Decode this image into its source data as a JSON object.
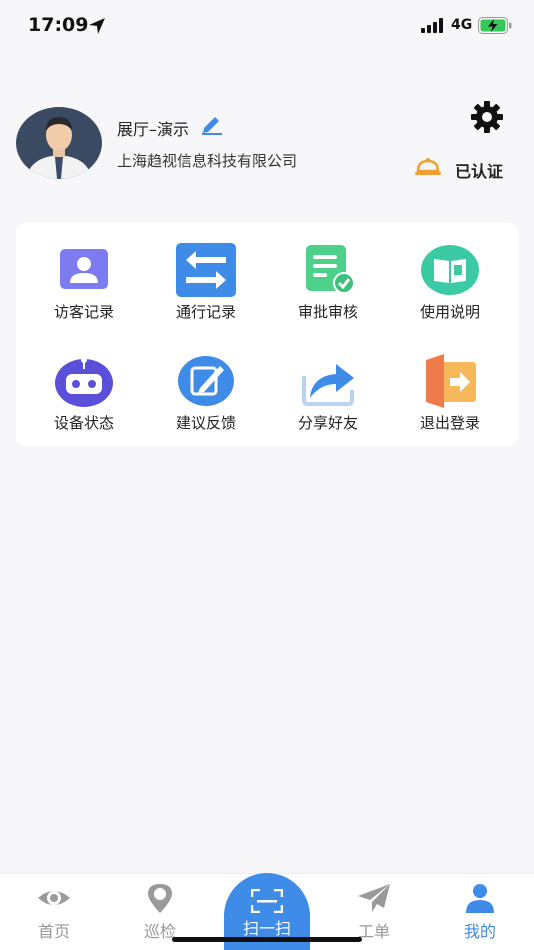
{
  "status_bar": {
    "time": "17:09",
    "network": "4G",
    "icons": [
      "location-arrow-icon",
      "signal-icon",
      "battery-charging-icon"
    ]
  },
  "profile": {
    "name": "展厅–演示",
    "company": "上海趋视信息科技有限公司",
    "verify_label": "已认证",
    "icons": [
      "avatar",
      "edit-icon",
      "settings-icon",
      "bell-icon"
    ],
    "accent_color": "#3f8be8"
  },
  "menu": {
    "items": [
      {
        "label": "访客记录",
        "icon": "visitor-record-icon",
        "color": "#7c7cf0"
      },
      {
        "label": "通行记录",
        "icon": "transfer-arrows-icon",
        "color": "#3f8be8"
      },
      {
        "label": "审批审核",
        "icon": "approval-check-icon",
        "color": "#4dd08a"
      },
      {
        "label": "使用说明",
        "icon": "book-icon",
        "color": "#3ccaa5"
      },
      {
        "label": "设备状态",
        "icon": "robot-icon",
        "color": "#5a4fd8"
      },
      {
        "label": "建议反馈",
        "icon": "feedback-pen-icon",
        "color": "#3f8be8"
      },
      {
        "label": "分享好友",
        "icon": "share-arrow-icon",
        "color": "#3f8be8"
      },
      {
        "label": "退出登录",
        "icon": "logout-door-icon",
        "color": "#f07b4a"
      }
    ]
  },
  "tab_bar": {
    "tabs": [
      {
        "label": "首页",
        "icon": "eye-icon"
      },
      {
        "label": "巡检",
        "icon": "patrol-pin-icon"
      },
      {
        "label": "工单",
        "icon": "paper-plane-icon"
      },
      {
        "label": "我的",
        "icon": "user-icon"
      }
    ],
    "scan_label": "扫一扫",
    "active_tab": "我的"
  }
}
